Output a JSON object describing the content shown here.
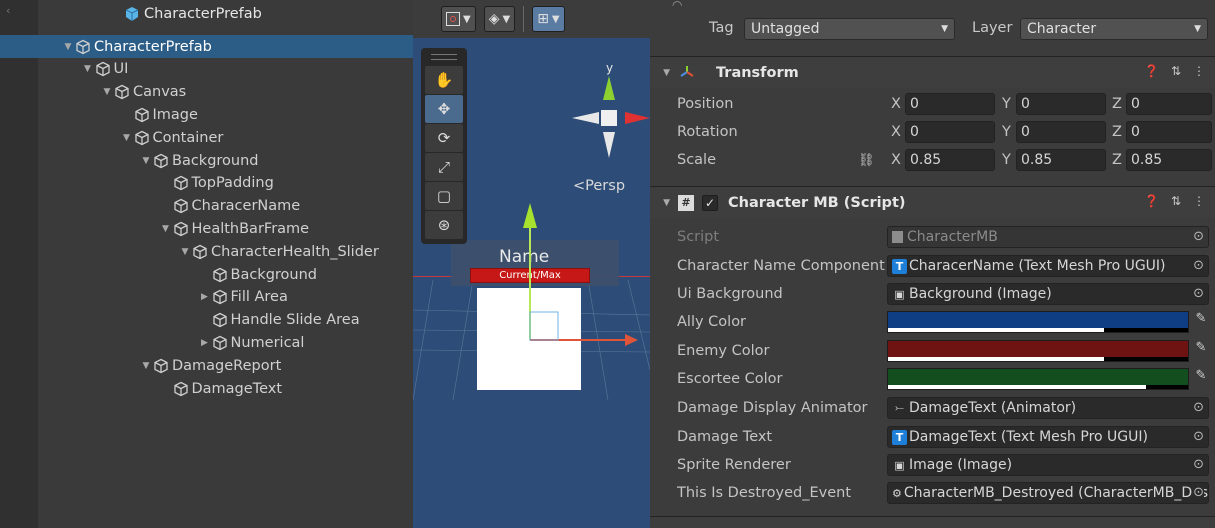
{
  "hierarchy": {
    "title": "CharacterPrefab",
    "rows": [
      {
        "label": "CharacterPrefab",
        "depth": 0,
        "fold": "open",
        "selected": true
      },
      {
        "label": "UI",
        "depth": 1,
        "fold": "open"
      },
      {
        "label": "Canvas",
        "depth": 2,
        "fold": "open"
      },
      {
        "label": "Image",
        "depth": 3,
        "fold": "none"
      },
      {
        "label": "Container",
        "depth": 3,
        "fold": "open"
      },
      {
        "label": "Background",
        "depth": 4,
        "fold": "open"
      },
      {
        "label": "TopPadding",
        "depth": 5,
        "fold": "none"
      },
      {
        "label": "CharacerName",
        "depth": 5,
        "fold": "none"
      },
      {
        "label": "HealthBarFrame",
        "depth": 5,
        "fold": "open"
      },
      {
        "label": "CharacterHealth_Slider",
        "depth": 6,
        "fold": "open"
      },
      {
        "label": "Background",
        "depth": 7,
        "fold": "none"
      },
      {
        "label": "Fill Area",
        "depth": 7,
        "fold": "closed"
      },
      {
        "label": "Handle Slide Area",
        "depth": 7,
        "fold": "none"
      },
      {
        "label": "Numerical",
        "depth": 7,
        "fold": "closed"
      },
      {
        "label": "DamageReport",
        "depth": 4,
        "fold": "open"
      },
      {
        "label": "DamageText",
        "depth": 5,
        "fold": "none"
      }
    ]
  },
  "scene": {
    "persp_label": "<Persp",
    "gizmo_axis": "y",
    "name_label": "Name",
    "health_text": "Current/Max"
  },
  "inspector": {
    "tag_label": "Tag",
    "tag_value": "Untagged",
    "layer_label": "Layer",
    "layer_value": "Character",
    "transform": {
      "title": "Transform",
      "position_label": "Position",
      "rotation_label": "Rotation",
      "scale_label": "Scale",
      "position": {
        "x": "0",
        "y": "0",
        "z": "0"
      },
      "rotation": {
        "x": "0",
        "y": "0",
        "z": "0"
      },
      "scale": {
        "x": "0.85",
        "y": "0.85",
        "z": "0.85"
      }
    },
    "character_mb": {
      "title": "Character MB (Script)",
      "enabled_mark": "✓",
      "script_label": "Script",
      "script_value": "CharacterMB",
      "name_component_label": "Character Name Component",
      "name_component_value": "CharacerName (Text Mesh Pro UGUI)",
      "ui_background_label": "Ui Background",
      "ui_background_value": "Background (Image)",
      "ally_color_label": "Ally Color",
      "ally_color": "#0f3e84",
      "ally_alpha": 0.72,
      "enemy_color_label": "Enemy Color",
      "enemy_color": "#6e1212",
      "enemy_alpha": 0.72,
      "escortee_color_label": "Escortee Color",
      "escortee_color": "#134e1f",
      "escortee_alpha": 0.86,
      "damage_animator_label": "Damage Display Animator",
      "damage_animator_value": "DamageText (Animator)",
      "damage_text_label": "Damage Text",
      "damage_text_value": "DamageText (Text Mesh Pro UGUI)",
      "sprite_renderer_label": "Sprite Renderer",
      "sprite_renderer_value": "Image (Image)",
      "destroyed_event_label": "This Is Destroyed_Event",
      "destroyed_event_value": "CharacterMB_Destroyed (CharacterMB_Destroyed)"
    }
  },
  "colors": {
    "selection": "#2c5d87",
    "scene_bg": "#2d4d78",
    "health_bar": "#c71818"
  },
  "icons": [
    "gameobject-cube-icon",
    "hand-icon",
    "move-icon",
    "rotate-icon",
    "scale-icon",
    "rect-icon",
    "transform-icon",
    "help-icon",
    "preset-icon",
    "menu-icon",
    "eyedropper-icon",
    "object-picker-icon"
  ]
}
